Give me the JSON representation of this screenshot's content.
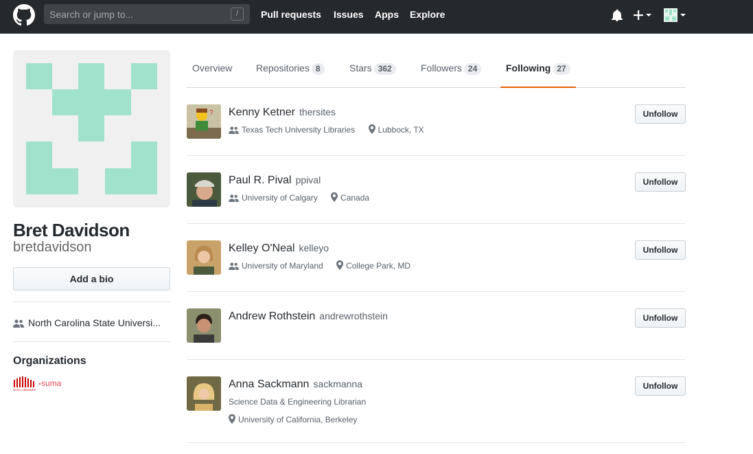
{
  "header": {
    "search_placeholder": "Search or jump to...",
    "search_shortcut": "/",
    "nav": [
      "Pull requests",
      "Issues",
      "Apps",
      "Explore"
    ],
    "icons": [
      "github-mark-icon",
      "bell-icon",
      "plus-icon",
      "user-avatar-icon"
    ],
    "colors": {
      "bar": "#24292e"
    }
  },
  "profile": {
    "full_name": "Bret Davidson",
    "username": "bretdavidson",
    "add_bio_label": "Add a bio",
    "organization": "North Carolina State Universi...",
    "organizations_heading": "Organizations",
    "org_logos": [
      "ncsu-libraries-logo",
      "suma-logo"
    ],
    "identicon_color": "#9ee2c9"
  },
  "tabs": [
    {
      "label": "Overview",
      "count": ""
    },
    {
      "label": "Repositories",
      "count": "8"
    },
    {
      "label": "Stars",
      "count": "362"
    },
    {
      "label": "Followers",
      "count": "24"
    },
    {
      "label": "Following",
      "count": "27",
      "active": true
    }
  ],
  "following": [
    {
      "name": "Kenny Ketner",
      "login": "thersites",
      "company": "Texas Tech University Libraries",
      "bio": "",
      "location": "Lubbock, TX",
      "button": "Unfollow"
    },
    {
      "name": "Paul R. Pival",
      "login": "ppival",
      "company": "University of Calgary",
      "bio": "",
      "location": "Canada",
      "button": "Unfollow"
    },
    {
      "name": "Kelley O'Neal",
      "login": "kelleyo",
      "company": "University of Maryland",
      "bio": "",
      "location": "College Park, MD",
      "button": "Unfollow"
    },
    {
      "name": "Andrew Rothstein",
      "login": "andrewrothstein",
      "company": "",
      "bio": "",
      "location": "",
      "button": "Unfollow"
    },
    {
      "name": "Anna Sackmann",
      "login": "sackmanna",
      "company": "",
      "bio": "Science Data & Engineering Librarian",
      "location": "University of California, Berkeley",
      "button": "Unfollow"
    }
  ],
  "org_logo_text": {
    "ncsu": "NCSU LIBRARIES",
    "suma": "suma"
  }
}
